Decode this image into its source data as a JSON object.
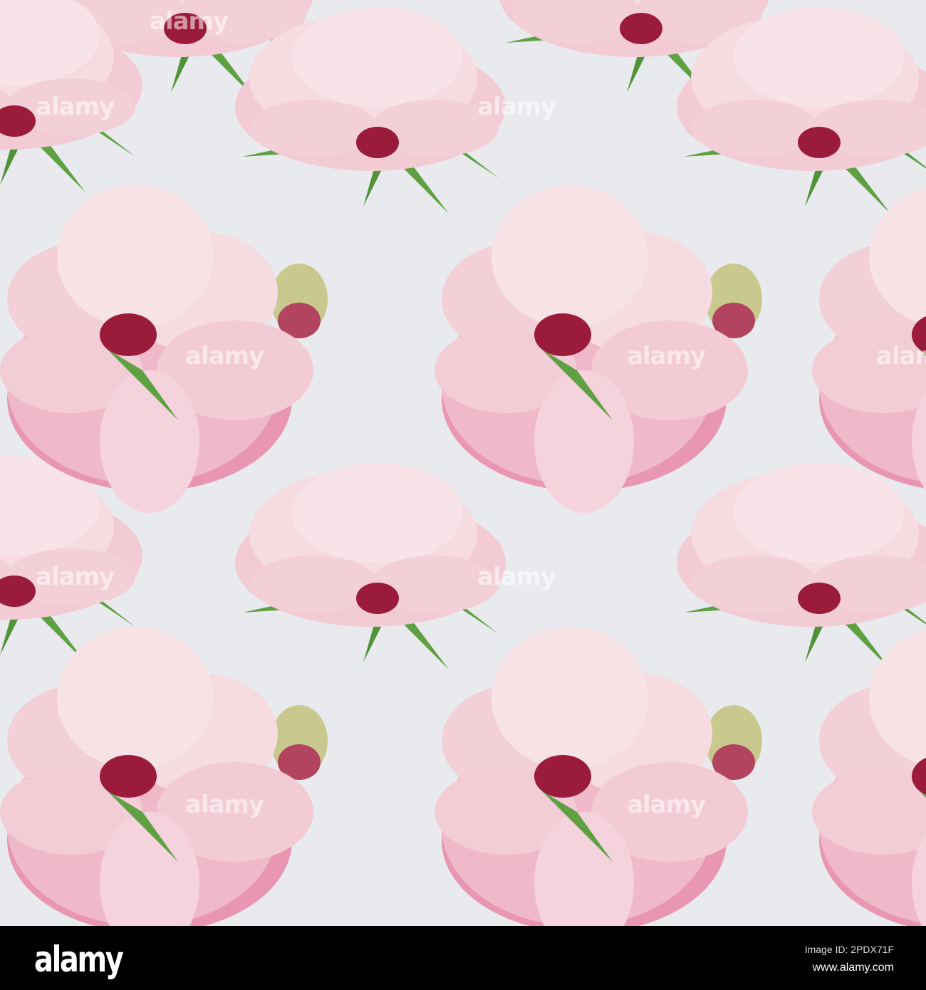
{
  "image": {
    "background_color": "#e8eaee",
    "petal_color": "#f3cfd8",
    "petal_shadow_color": "#e08aa6",
    "center_color": "#9b1b3b",
    "leaf_color": "#5fa043",
    "watermark_text": "alamy"
  },
  "footer": {
    "logo": "alamy",
    "image_id": "Image ID: 2PDX71F",
    "website": "www.alamy.com"
  }
}
